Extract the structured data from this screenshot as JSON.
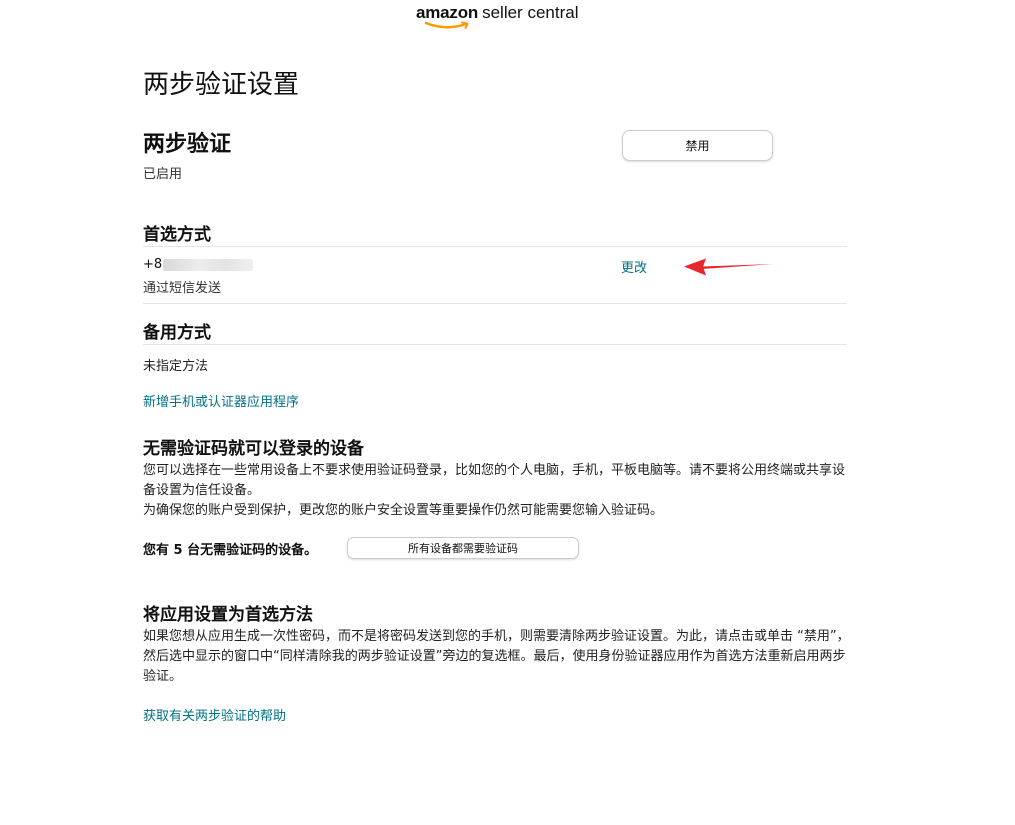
{
  "header": {
    "logo_amazon": "amazon",
    "logo_rest": "seller central"
  },
  "page": {
    "title": "两步验证设置"
  },
  "two_step": {
    "heading": "两步验证",
    "status": "已启用",
    "disable_button": "禁用"
  },
  "preferred": {
    "heading": "首选方式",
    "phone_prefix": "+8",
    "delivery": "通过短信发送",
    "change_link": "更改"
  },
  "backup": {
    "heading": "备用方式",
    "value": "未指定方法",
    "add_link": "新增手机或认证器应用程序"
  },
  "devices": {
    "heading": "无需验证码就可以登录的设备",
    "para1": "您可以选择在一些常用设备上不要求使用验证码登录，比如您的个人电脑，手机，平板电脑等。请不要将公用终端或共享设备设置为信任设备。",
    "para2": "为确保您的账户受到保护，更改您的账户安全设置等重要操作仍然可能需要您输入验证码。",
    "count_text": "您有 5 台无需验证码的设备。",
    "require_all_button": "所有设备都需要验证码"
  },
  "app_pref": {
    "heading": "将应用设置为首选方法",
    "para": "如果您想从应用生成一次性密码，而不是将密码发送到您的手机，则需要清除两步验证设置。为此，请点击或单击 “禁用”，然后选中显示的窗口中“同样清除我的两步验证设置”旁边的复选框。最后，使用身份验证器应用作为首选方法重新启用两步验证。",
    "help_link": "获取有关两步验证的帮助"
  },
  "colors": {
    "link": "#007185",
    "annotation_arrow": "#e8262b",
    "logo_smile": "#ff9900"
  }
}
